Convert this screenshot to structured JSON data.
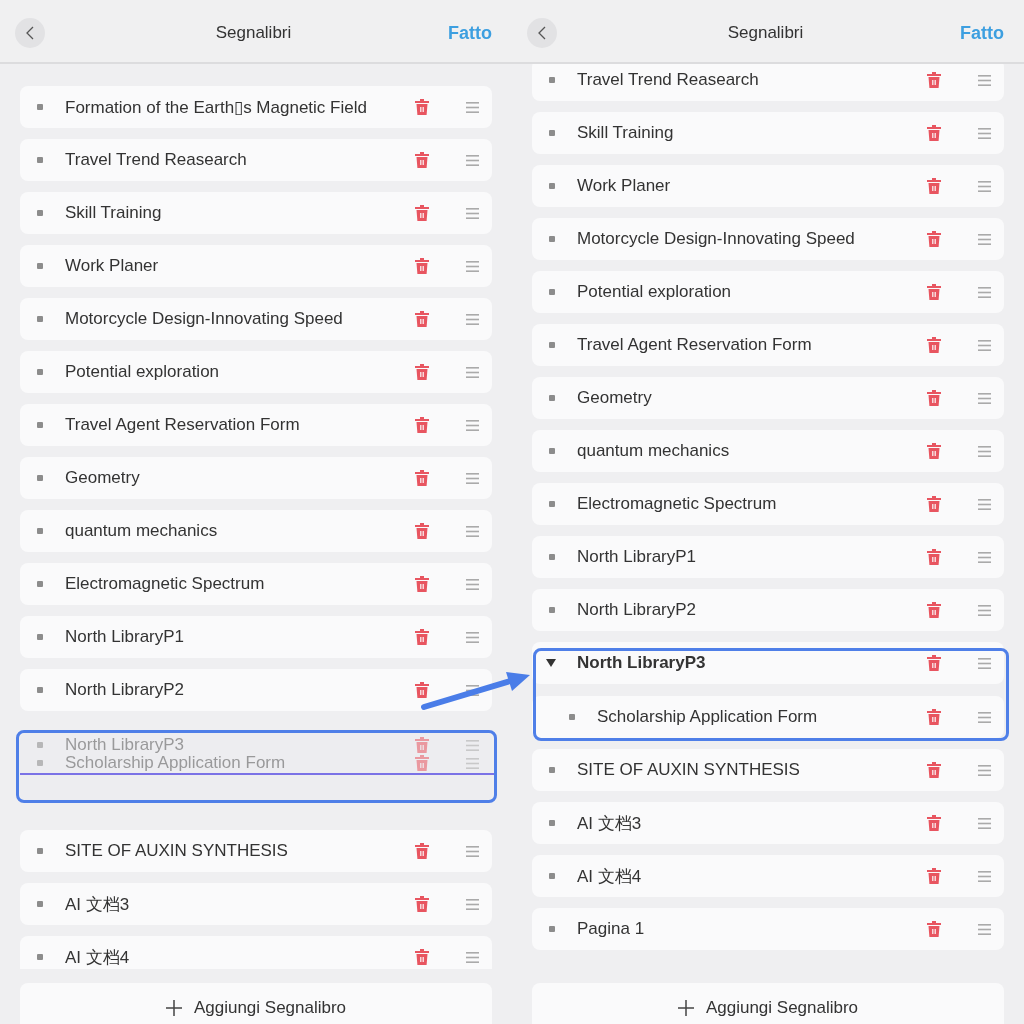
{
  "panels": [
    {
      "header": {
        "title": "Segnalibri",
        "done": "Fatto"
      },
      "scrolled": false,
      "items": [
        {
          "kind": "bookmark",
          "title": "Formation of the Earth▯s Magnetic Field"
        },
        {
          "kind": "bookmark",
          "title": "Travel Trend Reasearch"
        },
        {
          "kind": "bookmark",
          "title": "Skill Training"
        },
        {
          "kind": "bookmark",
          "title": "Work Planer"
        },
        {
          "kind": "bookmark",
          "title": "Motorcycle Design-Innovating Speed"
        },
        {
          "kind": "bookmark",
          "title": "Potential exploration"
        },
        {
          "kind": "bookmark",
          "title": "Travel Agent Reservation Form"
        },
        {
          "kind": "bookmark",
          "title": "Geometry"
        },
        {
          "kind": "bookmark",
          "title": "quantum mechanics"
        },
        {
          "kind": "bookmark",
          "title": "Electromagnetic Spectrum"
        },
        {
          "kind": "bookmark",
          "title": "North LibraryP1"
        },
        {
          "kind": "bookmark",
          "title": "North LibraryP2"
        },
        {
          "kind": "drag_slot",
          "highlighted": true,
          "dragged": [
            {
              "title": "North LibraryP3"
            },
            {
              "title": "Scholarship Application Form"
            }
          ]
        },
        {
          "kind": "bookmark",
          "title": "SITE OF AUXIN SYNTHESIS"
        },
        {
          "kind": "bookmark",
          "title": "AI 文档3"
        },
        {
          "kind": "bookmark",
          "title": "AI 文档4"
        }
      ],
      "add_button": "Aggiungi Segnalibro"
    },
    {
      "header": {
        "title": "Segnalibri",
        "done": "Fatto"
      },
      "scrolled": true,
      "items": [
        {
          "kind": "bookmark",
          "title": "Travel Trend Reasearch"
        },
        {
          "kind": "bookmark",
          "title": "Skill Training"
        },
        {
          "kind": "bookmark",
          "title": "Work Planer"
        },
        {
          "kind": "bookmark",
          "title": "Motorcycle Design-Innovating Speed"
        },
        {
          "kind": "bookmark",
          "title": "Potential exploration"
        },
        {
          "kind": "bookmark",
          "title": "Travel Agent Reservation Form"
        },
        {
          "kind": "bookmark",
          "title": "Geometry"
        },
        {
          "kind": "bookmark",
          "title": "quantum mechanics"
        },
        {
          "kind": "bookmark",
          "title": "Electromagnetic Spectrum"
        },
        {
          "kind": "bookmark",
          "title": "North LibraryP1"
        },
        {
          "kind": "bookmark",
          "title": "North LibraryP2"
        },
        {
          "kind": "group",
          "title": "North LibraryP3",
          "expanded": true,
          "highlighted": true,
          "children": [
            {
              "title": "Scholarship Application Form"
            }
          ]
        },
        {
          "kind": "bookmark",
          "title": "SITE OF AUXIN SYNTHESIS"
        },
        {
          "kind": "bookmark",
          "title": "AI 文档3"
        },
        {
          "kind": "bookmark",
          "title": "AI 文档4"
        },
        {
          "kind": "bookmark",
          "title": "Pagina 1"
        }
      ],
      "add_button": "Aggiungi Segnalibro"
    }
  ]
}
